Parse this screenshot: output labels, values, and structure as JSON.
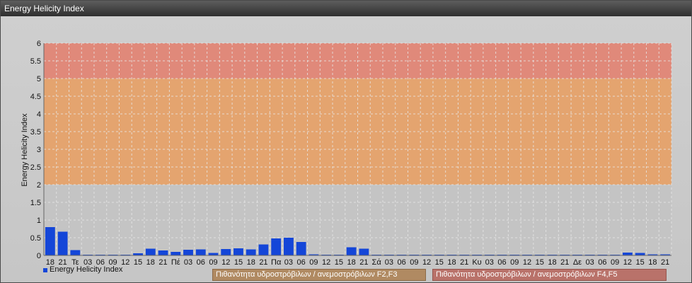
{
  "window": {
    "title": "Energy Helicity Index"
  },
  "colors": {
    "bar": "#1446d8",
    "band_high": "#e0897a",
    "band_mid": "#e4a46f",
    "band_low": "#d9956e",
    "grid": "#e8e8e8"
  },
  "legend": {
    "series_label": "Energy Helicity Index",
    "band_f2f3": "Πιθανότητα υδροστρόβιλων / ανεμοστρόβιλων F2,F3",
    "band_f4f5": "Πιθανότητα υδροστρόβιλων / ανεμοστρόβιλων F4,F5"
  },
  "chart_data": {
    "type": "bar",
    "ylabel": "Energy Helicity Index",
    "ylim": [
      0,
      6
    ],
    "yticks": [
      "0",
      "0.5",
      "1",
      "1.5",
      "2",
      "2.5",
      "3",
      "3.5",
      "4",
      "4.5",
      "5",
      "5.5",
      "6"
    ],
    "grid": true,
    "legend_position": "bottom-left",
    "bands": [
      {
        "from": 2,
        "to": 5,
        "label": "Πιθανότητα υδροστρόβιλων / ανεμοστρόβιλων F2,F3"
      },
      {
        "from": 5,
        "to": 6,
        "label": "Πιθανότητα υδροστρόβιλων / ανεμοστρόβιλων F4,F5"
      }
    ],
    "categories": [
      "18",
      "21",
      "Τε",
      "03",
      "06",
      "09",
      "12",
      "15",
      "18",
      "21",
      "Πέ",
      "03",
      "06",
      "09",
      "12",
      "15",
      "18",
      "21",
      "Πα",
      "03",
      "06",
      "09",
      "12",
      "15",
      "18",
      "21",
      "Σά",
      "03",
      "06",
      "09",
      "12",
      "15",
      "18",
      "21",
      "Κυ",
      "03",
      "06",
      "09",
      "12",
      "15",
      "18",
      "21",
      "Δε",
      "03",
      "06",
      "09",
      "12",
      "15",
      "18",
      "21"
    ],
    "series": [
      {
        "name": "Energy Helicity Index",
        "values": [
          0.8,
          0.67,
          0.15,
          0.02,
          0.02,
          0.02,
          0.02,
          0.06,
          0.19,
          0.14,
          0.1,
          0.16,
          0.17,
          0.07,
          0.18,
          0.2,
          0.17,
          0.31,
          0.48,
          0.5,
          0.38,
          0.03,
          0.02,
          0.02,
          0.23,
          0.19,
          0.02,
          0.02,
          0.02,
          0.02,
          0.02,
          0.02,
          0.02,
          0.02,
          0.02,
          0.02,
          0.02,
          0.02,
          0.02,
          0.02,
          0.02,
          0.02,
          0.02,
          0.02,
          0.02,
          0.02,
          0.08,
          0.07,
          0.03,
          0.03
        ]
      }
    ]
  }
}
